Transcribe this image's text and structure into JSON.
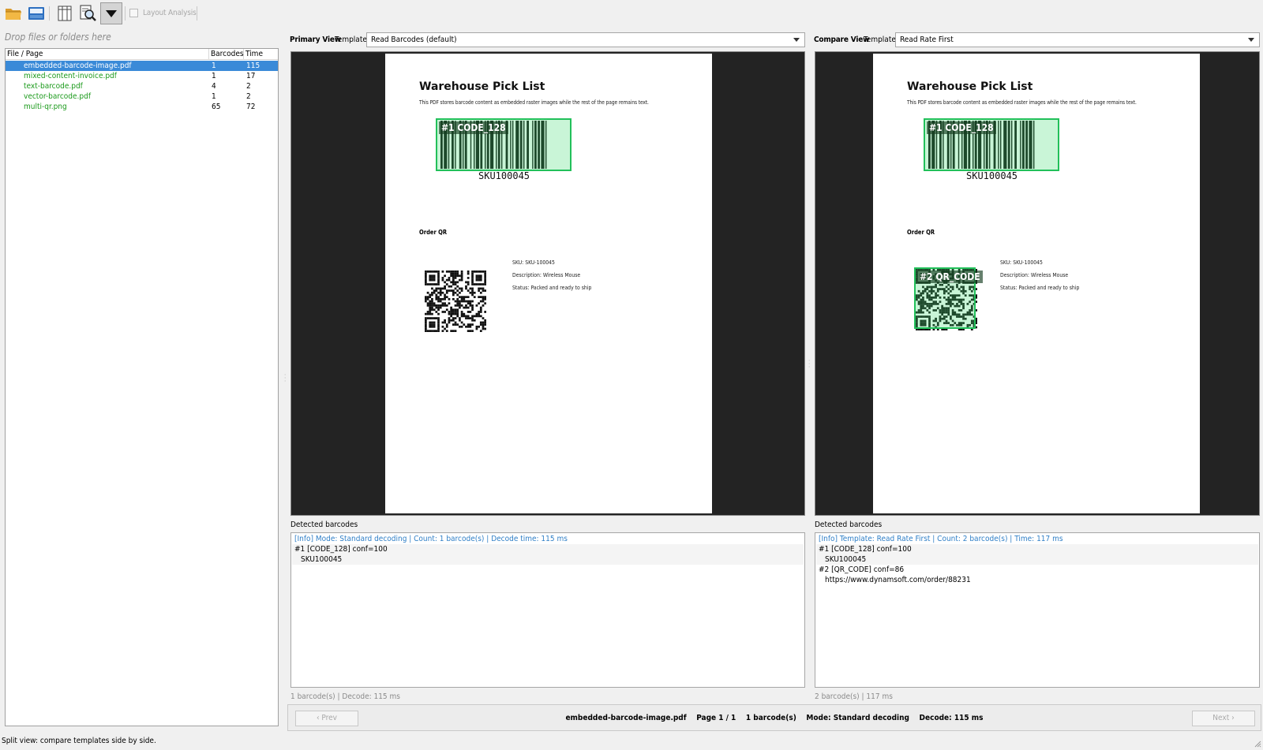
{
  "toolbar": {
    "icons": [
      "open-folder-icon",
      "save-icon",
      "columns-icon",
      "search-document-icon",
      "dropdown-arrow-icon"
    ],
    "layout_analysis_label": "Layout Analysis",
    "layout_analysis_checked": false
  },
  "left_panel": {
    "drop_hint": "Drop files or folders here",
    "columns": [
      "File / Page",
      "Barcodes",
      "Time (ms)"
    ],
    "files": [
      {
        "name": "embedded-barcode-image.pdf",
        "barcodes": "1",
        "time": "115",
        "selected": true
      },
      {
        "name": "mixed-content-invoice.pdf",
        "barcodes": "1",
        "time": "17",
        "selected": false
      },
      {
        "name": "text-barcode.pdf",
        "barcodes": "4",
        "time": "2",
        "selected": false
      },
      {
        "name": "vector-barcode.pdf",
        "barcodes": "1",
        "time": "2",
        "selected": false
      },
      {
        "name": "multi-qr.png",
        "barcodes": "65",
        "time": "72",
        "selected": false
      }
    ]
  },
  "document": {
    "title": "Warehouse Pick List",
    "subtitle": "This PDF stores barcode content as embedded raster images while the rest of the page remains text.",
    "sku_text": "SKU100045",
    "order_qr_label": "Order QR",
    "sku_line": "SKU: SKU-100045",
    "description_line": "Description: Wireless Mouse",
    "status_line": "Status: Packed and ready to ship"
  },
  "primary": {
    "view_label": "Primary View",
    "template_label": "Template:",
    "template_value": "Read Barcodes (default)",
    "overlays": [
      {
        "label": "#1 CODE_128"
      }
    ],
    "detected_label": "Detected barcodes",
    "results": {
      "info": "[Info] Mode: Standard decoding | Count: 1 barcode(s) | Decode time: 115 ms",
      "lines": [
        "#1 [CODE_128] conf=100",
        "SKU100045"
      ]
    },
    "stat": "1 barcode(s)  |  Decode: 115 ms"
  },
  "compare": {
    "view_label": "Compare View",
    "template_label": "Template:",
    "template_value": "Read Rate First",
    "overlays": [
      {
        "label": "#1 CODE_128"
      },
      {
        "label": "#2 QR_CODE"
      }
    ],
    "detected_label": "Detected barcodes",
    "results": {
      "info": "[Info] Template: Read Rate First | Count: 2 barcode(s) | Time: 117 ms",
      "lines": [
        "#1 [CODE_128] conf=100",
        "SKU100045",
        "#2 [QR_CODE] conf=86",
        "https://www.dynamsoft.com/order/88231"
      ]
    },
    "stat": "2 barcode(s)  |  117 ms"
  },
  "nav": {
    "prev_label": "‹ Prev",
    "next_label": "Next ›",
    "file": "embedded-barcode-image.pdf",
    "page": "Page 1 / 1",
    "count": "1 barcode(s)",
    "mode": "Mode: Standard decoding",
    "decode": "Decode: 115 ms"
  },
  "status_bar": "Split view: compare templates side by side."
}
